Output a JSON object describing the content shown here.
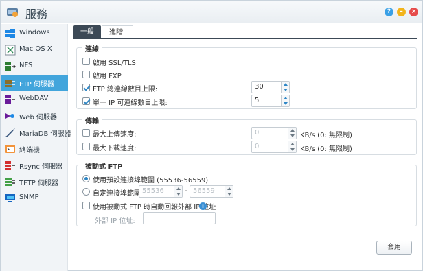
{
  "window": {
    "title": "服務",
    "buttons": {
      "help": "?",
      "minimize": "–",
      "close": "×"
    },
    "colors": {
      "help": "#3aa0e6",
      "minimize": "#f2b41b",
      "close": "#e64b4b"
    }
  },
  "sidebar": {
    "active_index": 3,
    "items": [
      {
        "label": "Windows",
        "icon": "windows-icon"
      },
      {
        "label": "Mac OS X",
        "icon": "macos-icon"
      },
      {
        "label": "NFS",
        "icon": "nfs-icon"
      },
      {
        "label": "FTP 伺服器",
        "icon": "ftp-icon"
      },
      {
        "label": "WebDAV",
        "icon": "webdav-icon"
      },
      {
        "label": "Web 伺服器",
        "icon": "web-server-icon"
      },
      {
        "label": "MariaDB 伺服器",
        "icon": "mariadb-icon"
      },
      {
        "label": "終端機",
        "icon": "terminal-icon"
      },
      {
        "label": "Rsync 伺服器",
        "icon": "rsync-icon"
      },
      {
        "label": "TFTP 伺服器",
        "icon": "tftp-icon"
      },
      {
        "label": "SNMP",
        "icon": "snmp-icon"
      }
    ]
  },
  "tabs": {
    "general": "一般",
    "advanced": "進階"
  },
  "connection": {
    "legend": "連線",
    "ssl_tls": {
      "label": "啟用 SSL/TLS",
      "checked": false
    },
    "fxp": {
      "label": "啟用 FXP",
      "checked": false
    },
    "max_connections": {
      "label": "FTP 總連線數目上限:",
      "checked": true,
      "value": "30"
    },
    "max_per_ip": {
      "label": "單一 IP 可連線數目上限:",
      "checked": true,
      "value": "5"
    }
  },
  "transfer": {
    "legend": "傳輸",
    "max_upload": {
      "label": "最大上傳速度:",
      "checked": false,
      "value": "0",
      "unit": "KB/s (0: 無限制)"
    },
    "max_download": {
      "label": "最大下載速度:",
      "checked": false,
      "value": "0",
      "unit": "KB/s (0: 無限制)"
    }
  },
  "passive": {
    "legend": "被動式 FTP",
    "default_range": {
      "label": "使用預設連接埠範圍 (55536-56559)",
      "selected": true
    },
    "custom_range": {
      "label": "自定連接埠範圍:",
      "selected": false,
      "from": "55536",
      "separator": "-",
      "to": "56559"
    },
    "report_external_ip": {
      "label": "使用被動式 FTP 時自動回報外部 IP 位址",
      "checked": false
    },
    "external_ip": {
      "label": "外部 IP 位址:",
      "value": ""
    }
  },
  "apply_label": "套用"
}
